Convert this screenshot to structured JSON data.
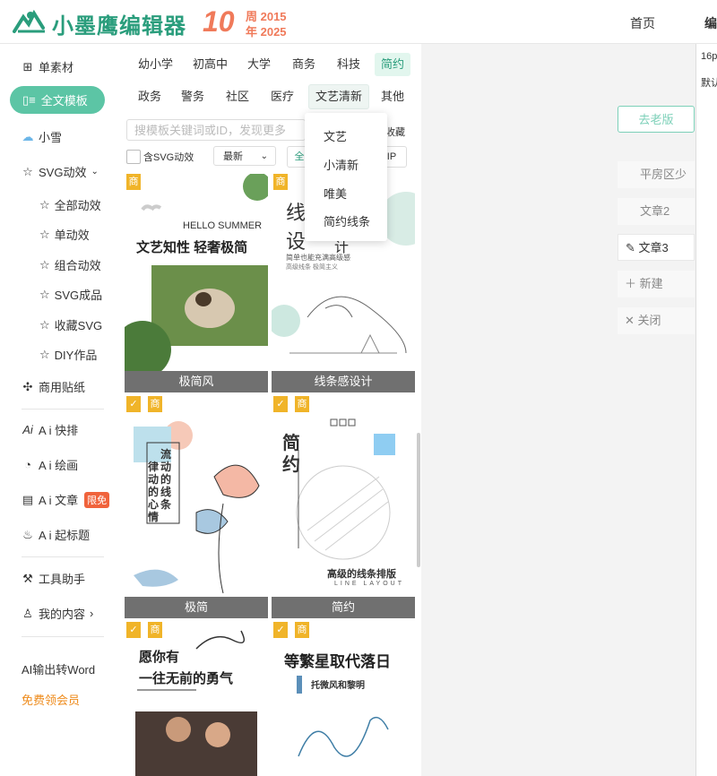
{
  "header": {
    "logo_text": "小墨鹰编辑器",
    "anniv_number": "10",
    "anniv_line1": "周 2015",
    "anniv_line2": "年 2025",
    "nav_home": "首页",
    "nav_edit": "编"
  },
  "sidebar": {
    "single_material": "单素材",
    "full_template": "全文模板",
    "xiaoxue": "小雪",
    "svg_effects": "SVG动效",
    "svg_sub": [
      "全部动效",
      "单动效",
      "组合动效",
      "SVG成品",
      "收藏SVG",
      "DIY作品"
    ],
    "commercial_stickers": "商用贴纸",
    "ai_layout": "A i 快排",
    "ai_draw": "A i 绘画",
    "ai_article": "A i 文章",
    "free_badge": "限免",
    "ai_title": "A i 起标题",
    "tools": "工具助手",
    "my_content": "我的内容",
    "ai_word": "AI输出转Word",
    "free_vip": "免费领会员"
  },
  "categories": {
    "row1": [
      "幼小学",
      "初高中",
      "大学",
      "商务",
      "科技",
      "简约"
    ],
    "row2": [
      "政务",
      "警务",
      "社区",
      "医疗",
      "文艺清新",
      "其他"
    ]
  },
  "filters": {
    "search_placeholder": "搜模板关键词或ID，发现更多",
    "fav_label": "收藏",
    "svg_check_label": "含SVG动效",
    "sort_value": "最新",
    "chip_left": "全",
    "chip_vip": "IP"
  },
  "dropdown": [
    "文艺",
    "小清新",
    "唯美",
    "简约线条"
  ],
  "cards": [
    {
      "label": "极简风",
      "tag": "商",
      "t1": "HELLO SUMMER",
      "t2": "文艺知性 轻奢极简"
    },
    {
      "label": "线条感设计",
      "tag": "商",
      "t1": "线",
      "t2": "设",
      "t3": "计",
      "t4": "简单也能充满高级感",
      "t5": "高级线条 极简主义"
    },
    {
      "label": "极简",
      "tag": "商",
      "t1": "流动的线条",
      "t2": "律动的心情"
    },
    {
      "label": "简约",
      "tag": "商",
      "t1": "简",
      "t2": "约",
      "t3": "高级的线条排版",
      "t4": "LINE LAYOUT"
    },
    {
      "tag": "商",
      "t1": "愿你有",
      "t2": "一往无前的勇气"
    },
    {
      "tag": "商",
      "t1": "等繁星取代落日",
      "t2": "托微风和黎明"
    }
  ],
  "right": {
    "old_version": "去老版",
    "tabs": [
      "平房区少",
      "文章2",
      "文章3"
    ],
    "new_label": "新建",
    "close_label": "关闭",
    "panel_size": "16p",
    "panel_default": "默认"
  },
  "colors": {
    "brand": "#2a9d7c",
    "active_pill": "#5cc5a5",
    "accent_orange": "#f07a5a",
    "tag_gold": "#f0b429"
  }
}
